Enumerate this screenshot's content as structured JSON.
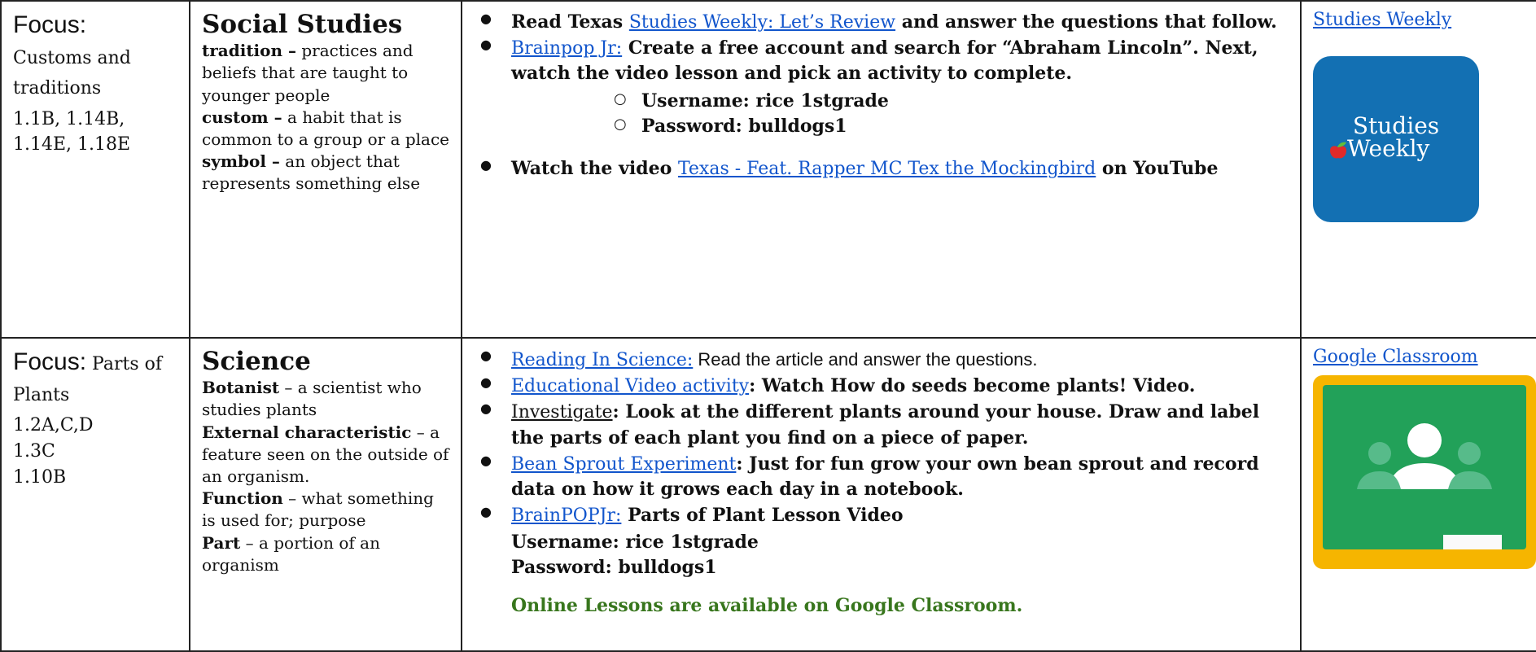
{
  "row1": {
    "focus_label": "Focus:",
    "focus_topic": "Customs and traditions",
    "standards": "1.1B, 1.14B, 1.14E, 1.18E",
    "subject": "Social Studies",
    "vocab": [
      {
        "term": "tradition –",
        "def": " practices and beliefs that are taught to younger people"
      },
      {
        "term": "custom –",
        "def": " a habit that is common to a group or a place"
      },
      {
        "term": "symbol –",
        "def": " an object that represents something else"
      }
    ],
    "task1_pre": "Read Texas ",
    "task1_link": "Studies Weekly: Let’s Review",
    "task1_post": " and answer the questions that follow.",
    "task2_link": "Brainpop Jr:",
    "task2_text": " Create a free account and search for “Abraham Lincoln”. Next, watch the video lesson and pick an activity to complete.",
    "username": "Username: rice 1stgrade",
    "password": "Password:  bulldogs1",
    "task3_pre": "Watch the video ",
    "task3_link": "Texas - Feat. Rapper MC Tex the Mockingbird",
    "task3_post": " on YouTube",
    "resource_link": "Studies Weekly",
    "logo_line1": "Studies",
    "logo_line2": "Weekly"
  },
  "row2": {
    "focus_label": "Focus:",
    "focus_topic": " Parts of Plants",
    "standards": [
      "1.2A,C,D",
      "1.3C",
      "1.10B"
    ],
    "subject": "Science",
    "vocab": [
      {
        "term": "Botanist",
        "def": " – a scientist who studies plants"
      },
      {
        "term": "External characteristic",
        "def": " – a feature seen on the outside of an organism."
      },
      {
        "term": "Function",
        "def": " – what something is used for; purpose"
      },
      {
        "term": "Part",
        "def": " – a portion of an organism"
      }
    ],
    "task1_link": "Reading In Science:",
    "task1_text": " Read the article and answer the questions.",
    "task2_link": "Educational Video activity",
    "task2_text": ": Watch How do seeds become plants! Video.",
    "task3_label": "Investigate",
    "task3_text": ": Look at the different plants around your house. Draw and label the parts of each plant you find on a piece of paper.",
    "task4_link": "Bean Sprout Experiment",
    "task4_text": ": Just for fun  grow your own bean sprout and record data on how it grows each day in a notebook.",
    "task5_link": "BrainPOPJr:",
    "task5_text": " Parts of Plant Lesson Video",
    "username": "Username: rice 1stgrade",
    "password": "Password:  bulldogs1",
    "online_note": "Online Lessons are available on Google Classroom.",
    "resource_link": "Google Classroom"
  },
  "colors": {
    "link": "#1155cc",
    "online_note": "#38761d",
    "sw_logo_bg": "#1370b3",
    "gc_frame": "#f6b500",
    "gc_board": "#22a159"
  }
}
